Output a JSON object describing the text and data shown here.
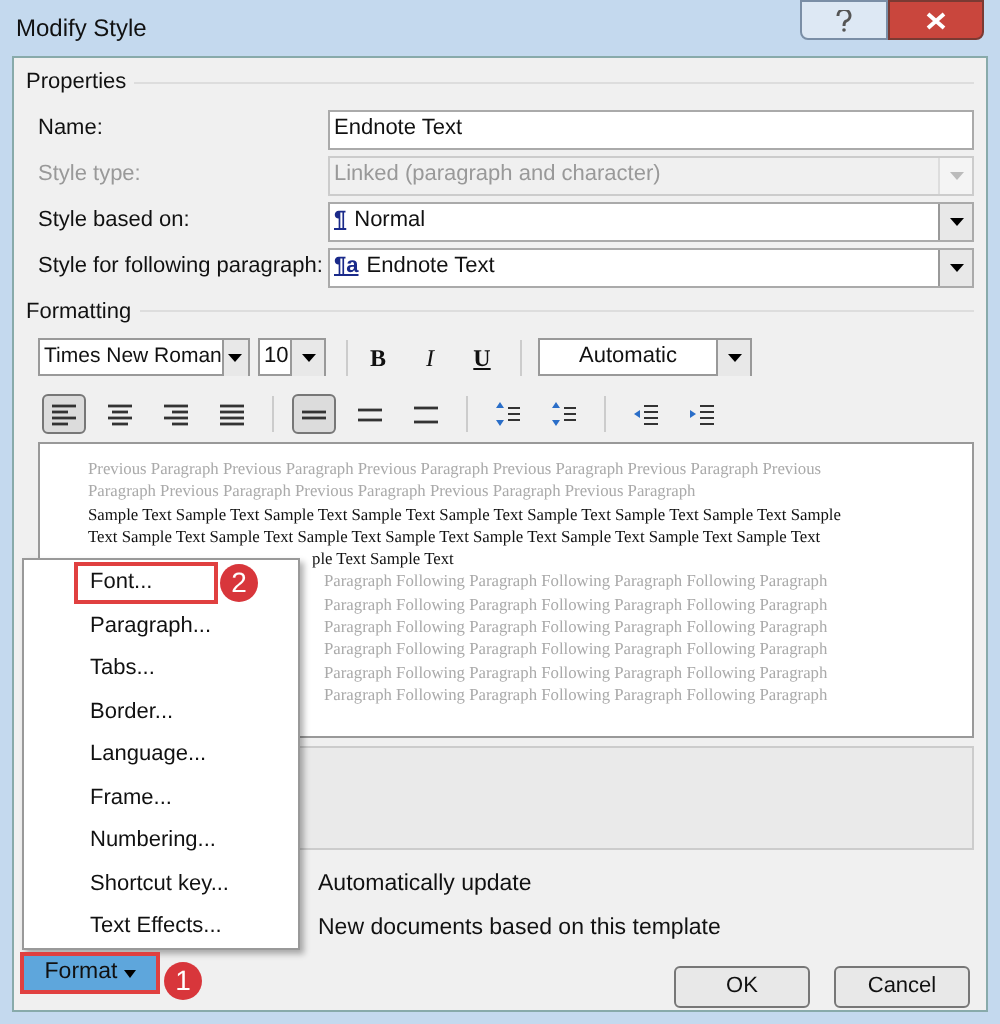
{
  "window": {
    "title": "Modify Style"
  },
  "properties": {
    "heading": "Properties",
    "rows": [
      {
        "label": "Name:",
        "kind": "text",
        "value": "Endnote Text",
        "disabled": false
      },
      {
        "label": "Style type:",
        "kind": "combo",
        "value": "Linked (paragraph and character)",
        "disabled": true
      },
      {
        "label": "Style based on:",
        "kind": "combo",
        "glyph": "¶",
        "value": "Normal",
        "disabled": false
      },
      {
        "label": "Style for following paragraph:",
        "kind": "combo",
        "glyph": "¶a",
        "value": "Endnote Text",
        "disabled": false
      }
    ]
  },
  "formatting": {
    "heading": "Formatting",
    "font": "Times New Roman",
    "size": "10",
    "bold": "B",
    "italic": "I",
    "underline": "U",
    "font_color": "Automatic",
    "alignment": [
      {
        "kind": "left",
        "selected": true
      },
      {
        "kind": "center",
        "selected": false
      },
      {
        "kind": "right",
        "selected": false
      },
      {
        "kind": "justify",
        "selected": false
      }
    ],
    "spacing": [
      {
        "kind": "single",
        "selected": true
      },
      {
        "kind": "onehalf",
        "selected": false
      },
      {
        "kind": "double",
        "selected": false
      }
    ]
  },
  "preview": {
    "lines": [
      {
        "kind": "previous",
        "text": "Previous Paragraph Previous Paragraph Previous Paragraph Previous Paragraph Previous Paragraph Previous"
      },
      {
        "kind": "previous",
        "text": "Paragraph Previous Paragraph Previous Paragraph Previous Paragraph Previous Paragraph"
      },
      {
        "kind": "sample",
        "text": "Sample Text Sample Text Sample Text Sample Text Sample Text Sample Text Sample Text Sample Text Sample"
      },
      {
        "kind": "sample",
        "text": "Text Sample Text Sample Text Sample Text Sample Text Sample Text Sample Text Sample Text Sample Text"
      },
      {
        "kind": "sample-cut",
        "text": "ple Text Sample Text"
      },
      {
        "kind": "following",
        "text": "Paragraph Following Paragraph Following Paragraph Following Paragraph"
      },
      {
        "kind": "following",
        "text": "Paragraph Following Paragraph Following Paragraph Following Paragraph"
      },
      {
        "kind": "following",
        "text": "Paragraph Following Paragraph Following Paragraph Following Paragraph"
      },
      {
        "kind": "following",
        "text": "Paragraph Following Paragraph Following Paragraph Following Paragraph"
      },
      {
        "kind": "following",
        "text": "Paragraph Following Paragraph Following Paragraph Following Paragraph"
      },
      {
        "kind": "following",
        "text": "Paragraph Following Paragraph Following Paragraph Following Paragraph"
      }
    ]
  },
  "options": [
    "Automatically update",
    "New documents based on this template"
  ],
  "format_menu": {
    "items": [
      {
        "label": "Font...",
        "highlighted": true
      },
      {
        "label": "Paragraph...",
        "highlighted": false
      },
      {
        "label": "Tabs...",
        "highlighted": false
      },
      {
        "label": "Border...",
        "highlighted": false
      },
      {
        "label": "Language...",
        "highlighted": false
      },
      {
        "label": "Frame...",
        "highlighted": false
      },
      {
        "label": "Numbering...",
        "highlighted": false
      },
      {
        "label": "Shortcut key...",
        "highlighted": false
      },
      {
        "label": "Text Effects...",
        "highlighted": false
      }
    ]
  },
  "callouts": [
    "1",
    "2"
  ],
  "buttons": {
    "format": "Format",
    "ok": "OK",
    "cancel": "Cancel"
  }
}
